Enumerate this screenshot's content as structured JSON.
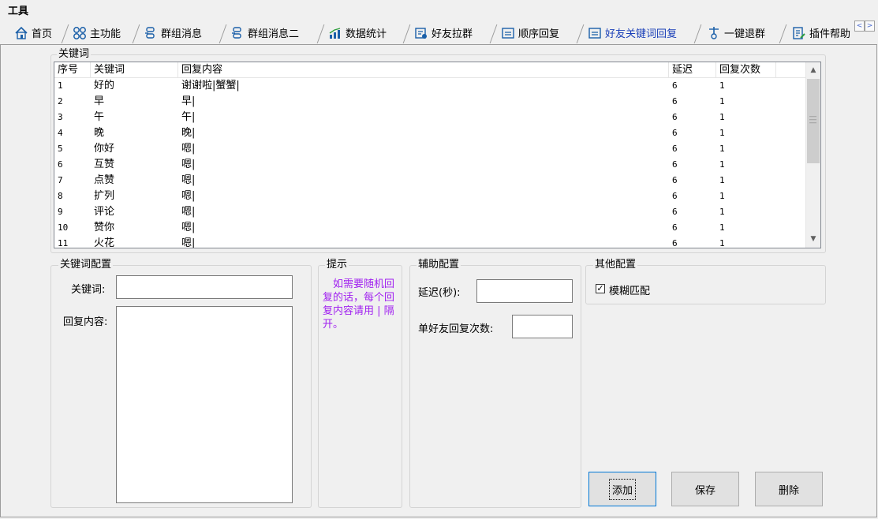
{
  "menu": {
    "title": "工具"
  },
  "tabs": [
    {
      "label": "首页",
      "icon": "home-icon"
    },
    {
      "label": "主功能",
      "icon": "grid-icon"
    },
    {
      "label": "群组消息",
      "icon": "group-icon"
    },
    {
      "label": "群组消息二",
      "icon": "group-icon"
    },
    {
      "label": "数据统计",
      "icon": "chart-icon"
    },
    {
      "label": "好友拉群",
      "icon": "user-add-icon"
    },
    {
      "label": "顺序回复",
      "icon": "reply-icon"
    },
    {
      "label": "好友关键词回复",
      "icon": "reply-icon",
      "active": true
    },
    {
      "label": "一键退群",
      "icon": "exit-icon"
    },
    {
      "label": "插件帮助",
      "icon": "help-icon"
    }
  ],
  "keywords_group": {
    "label": "关键词",
    "columns": [
      "序号",
      "关键词",
      "回复内容",
      "延迟",
      "回复次数"
    ],
    "rows": [
      [
        "1",
        "好的",
        "谢谢啦|蟹蟹|",
        "6",
        "1"
      ],
      [
        "2",
        "早",
        "早|",
        "6",
        "1"
      ],
      [
        "3",
        "午",
        "午|",
        "6",
        "1"
      ],
      [
        "4",
        "晚",
        "晚|",
        "6",
        "1"
      ],
      [
        "5",
        "你好",
        "嗯|",
        "6",
        "1"
      ],
      [
        "6",
        "互赞",
        "嗯|",
        "6",
        "1"
      ],
      [
        "7",
        "点赞",
        "嗯|",
        "6",
        "1"
      ],
      [
        "8",
        "扩列",
        "嗯|",
        "6",
        "1"
      ],
      [
        "9",
        "评论",
        "嗯|",
        "6",
        "1"
      ],
      [
        "10",
        "赞你",
        "嗯|",
        "6",
        "1"
      ],
      [
        "11",
        "火花",
        "嗯|",
        "6",
        "1"
      ]
    ]
  },
  "keyword_config": {
    "label": "关键词配置",
    "keyword_label": "关键词:",
    "keyword_value": "",
    "reply_label": "回复内容:",
    "reply_value": ""
  },
  "hint": {
    "label": "提示",
    "text": "如需要随机回复的话，每个回复内容请用 | 隔开。"
  },
  "aux_config": {
    "label": "辅助配置",
    "delay_label": "延迟(秒):",
    "delay_value": "",
    "count_label": "单好友回复次数:",
    "count_value": ""
  },
  "other_config": {
    "label": "其他配置",
    "fuzzy_label": "模糊匹配",
    "fuzzy_checked": true
  },
  "buttons": {
    "add": "添加",
    "save": "保存",
    "delete": "删除"
  },
  "colors": {
    "active_tab": "#1a3fb8",
    "hint_text": "#a020f0"
  }
}
